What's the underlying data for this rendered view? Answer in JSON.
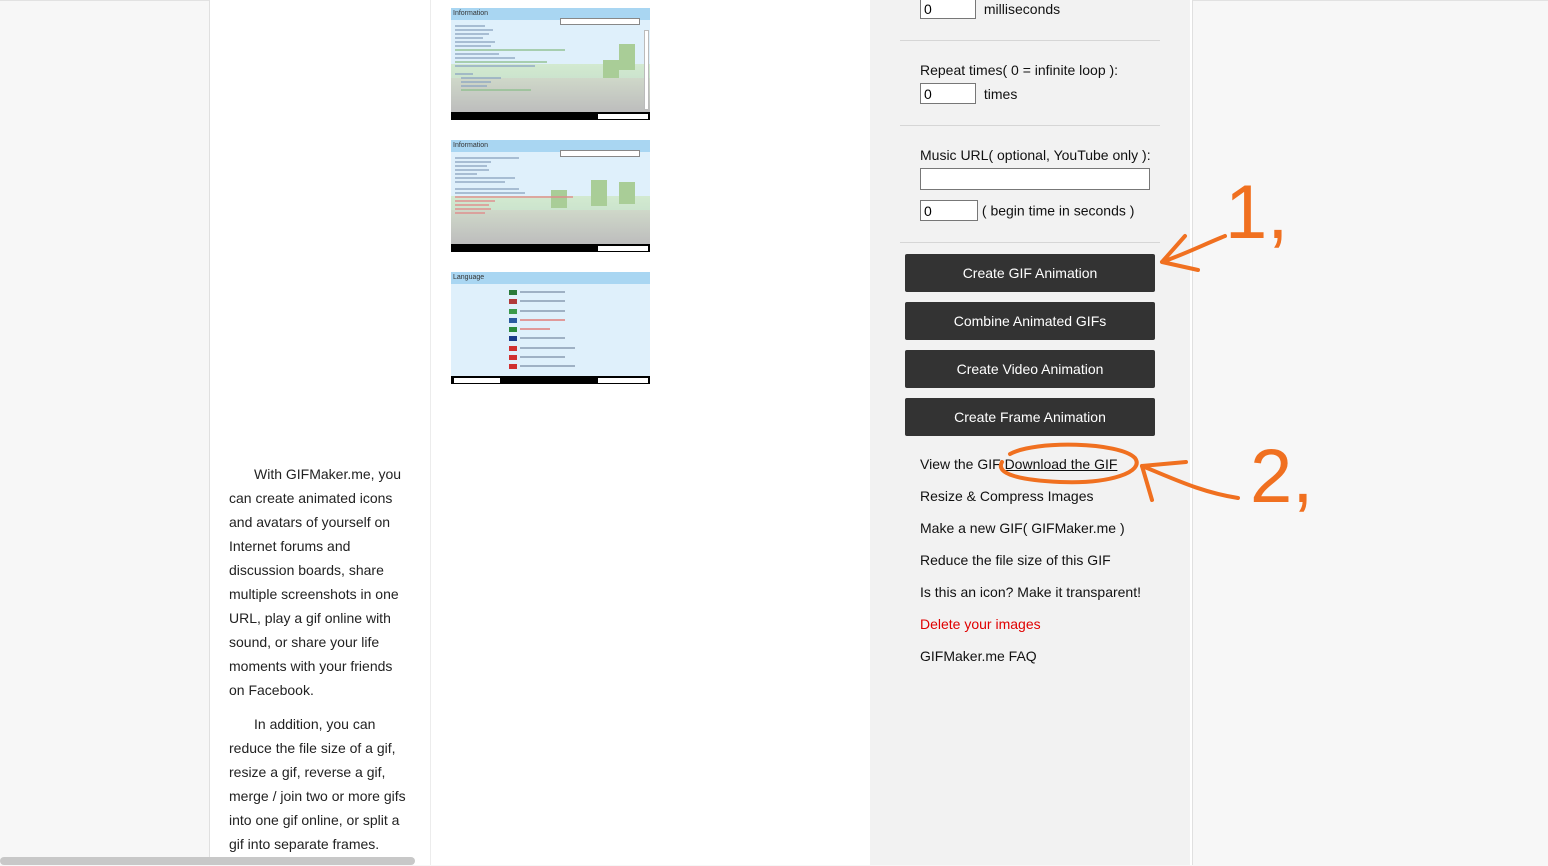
{
  "left_text": {
    "p1": "With GIFMaker.me, you can create animated icons and avatars of yourself on Internet forums and discussion boards, share multiple screenshots in one URL, play a gif online with sound, or share your life moments with your friends on Facebook.",
    "p2": "In addition, you can reduce the file size of a gif, resize a gif, reverse a gif, merge / join two or more gifs into one gif online, or split a gif into separate frames."
  },
  "thumbnails": [
    {
      "title": "Information"
    },
    {
      "title": "Information"
    },
    {
      "title": "Language"
    }
  ],
  "settings": {
    "delay_value": "0",
    "delay_unit": "milliseconds",
    "repeat_label": "Repeat times( 0 = infinite loop ):",
    "repeat_value": "0",
    "repeat_unit": "times",
    "music_label": "Music URL( optional, YouTube only ):",
    "music_url_value": "",
    "begin_value": "0",
    "begin_unit": "( begin time in seconds )"
  },
  "buttons": {
    "create_gif": "Create GIF Animation",
    "combine_gifs": "Combine Animated GIFs",
    "create_video": "Create Video Animation",
    "create_frame": "Create Frame Animation"
  },
  "links": {
    "view_gif": "View the GIF",
    "download_gif": "Download the GIF",
    "resize": "Resize & Compress Images",
    "make_new": "Make a new GIF( GIFMaker.me )",
    "reduce": "Reduce the file size of this GIF",
    "icon": "Is this an icon? Make it transparent!",
    "delete": "Delete your images",
    "faq": "GIFMaker.me FAQ"
  },
  "annotations": {
    "step1": "1,",
    "step2": "2,",
    "color": "#f07020"
  }
}
